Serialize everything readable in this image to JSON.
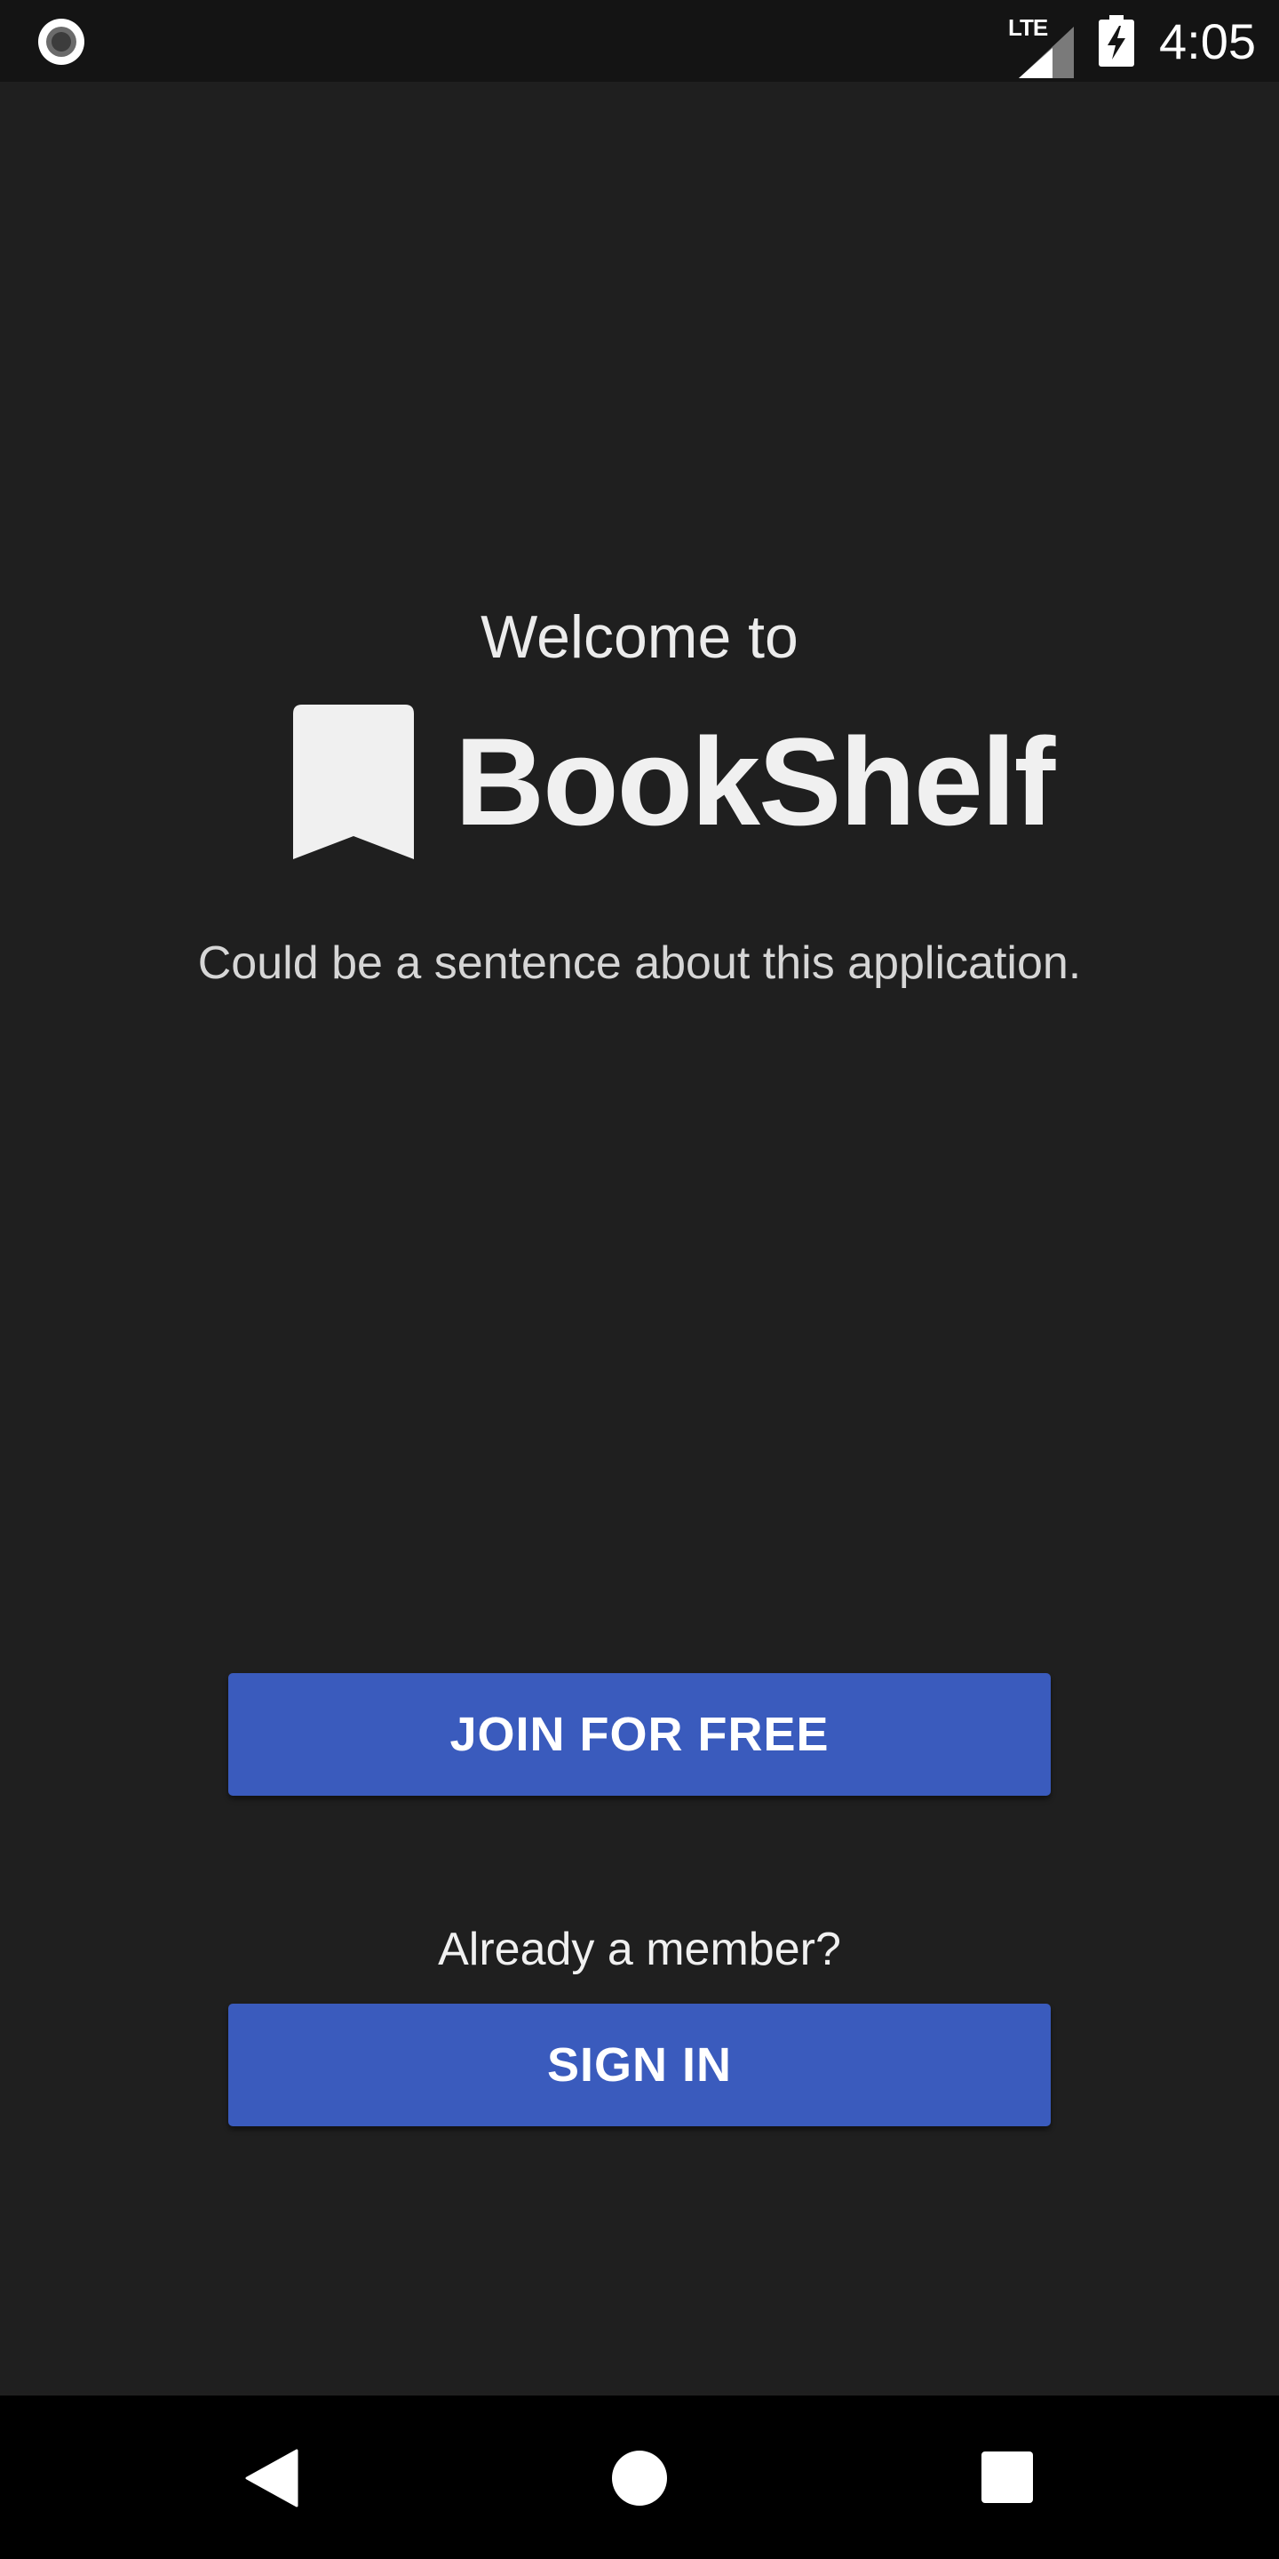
{
  "status_bar": {
    "left_icon": "record-circle-icon",
    "network_label": "LTE",
    "signal_icon": "cell-signal-icon",
    "battery_icon": "battery-charging-icon",
    "time": "4:05"
  },
  "welcome": {
    "greeting": "Welcome to",
    "logo_icon": "bookmark-icon",
    "app_name": "BookShelf",
    "tagline": "Could be a sentence about this application."
  },
  "actions": {
    "join_label": "JOIN FOR FREE",
    "member_prompt": "Already a member?",
    "signin_label": "SIGN IN"
  },
  "nav_bar": {
    "back_icon": "back-triangle-icon",
    "home_icon": "home-circle-icon",
    "recents_icon": "recents-square-icon"
  },
  "colors": {
    "background": "#1f1f1f",
    "status_bar": "#141414",
    "nav_bar": "#000000",
    "button": "#3a5bbd",
    "text_primary": "#f0f0f0"
  }
}
